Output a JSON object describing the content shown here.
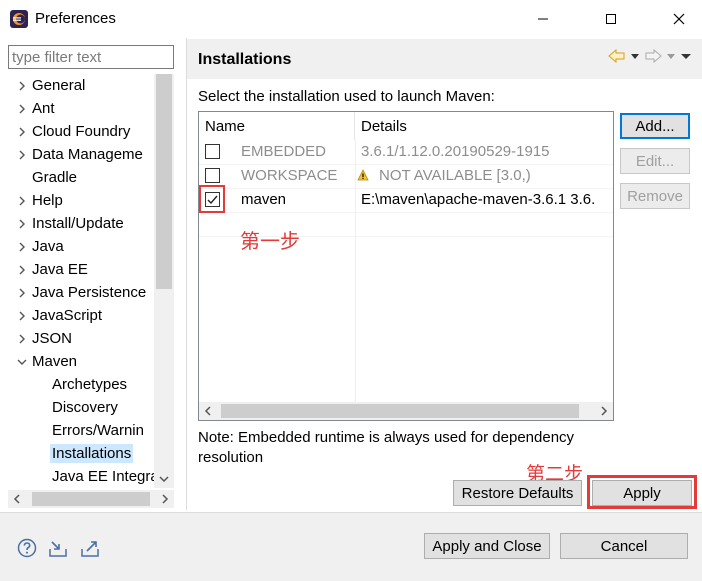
{
  "window": {
    "title": "Preferences"
  },
  "filter": {
    "placeholder": "type filter text"
  },
  "tree": {
    "items": [
      {
        "label": "General",
        "expandable": true
      },
      {
        "label": "Ant",
        "expandable": true
      },
      {
        "label": "Cloud Foundry",
        "expandable": true
      },
      {
        "label": "Data Manageme",
        "expandable": true
      },
      {
        "label": "Gradle",
        "expandable": false
      },
      {
        "label": "Help",
        "expandable": true
      },
      {
        "label": "Install/Update",
        "expandable": true
      },
      {
        "label": "Java",
        "expandable": true
      },
      {
        "label": "Java EE",
        "expandable": true
      },
      {
        "label": "Java Persistence",
        "expandable": true
      },
      {
        "label": "JavaScript",
        "expandable": true
      },
      {
        "label": "JSON",
        "expandable": true
      },
      {
        "label": "Maven",
        "expandable": true,
        "expanded": true
      },
      {
        "label": "Archetypes",
        "child": true
      },
      {
        "label": "Discovery",
        "child": true
      },
      {
        "label": "Errors/Warnin",
        "child": true
      },
      {
        "label": "Installations",
        "child": true,
        "selected": true
      },
      {
        "label": "Java EE Integra",
        "child": true
      }
    ]
  },
  "page": {
    "title": "Installations",
    "instruction": "Select the installation used to launch Maven:",
    "table": {
      "headers": {
        "name": "Name",
        "details": "Details"
      },
      "rows": [
        {
          "name": "EMBEDDED",
          "details": "3.6.1/1.12.0.20190529-1915",
          "checked": false,
          "disabled": true
        },
        {
          "name": "WORKSPACE",
          "details": "NOT AVAILABLE [3.0,)",
          "checked": false,
          "disabled": true,
          "warning": true
        },
        {
          "name": "maven",
          "details": "E:\\maven\\apache-maven-3.6.1 3.6.",
          "checked": true,
          "disabled": false
        }
      ]
    },
    "buttons": {
      "add": "Add...",
      "edit": "Edit...",
      "remove": "Remove"
    },
    "note": "Note: Embedded runtime is always used for dependency resolution",
    "restore_defaults": "Restore Defaults",
    "apply": "Apply"
  },
  "annotations": {
    "step1": "第一步",
    "step2": "第二步"
  },
  "footer": {
    "apply_and_close": "Apply and Close",
    "cancel": "Cancel"
  },
  "colors": {
    "accent": "#0078d7",
    "annotation": "#e33a3a",
    "selection": "#cce8ff"
  }
}
